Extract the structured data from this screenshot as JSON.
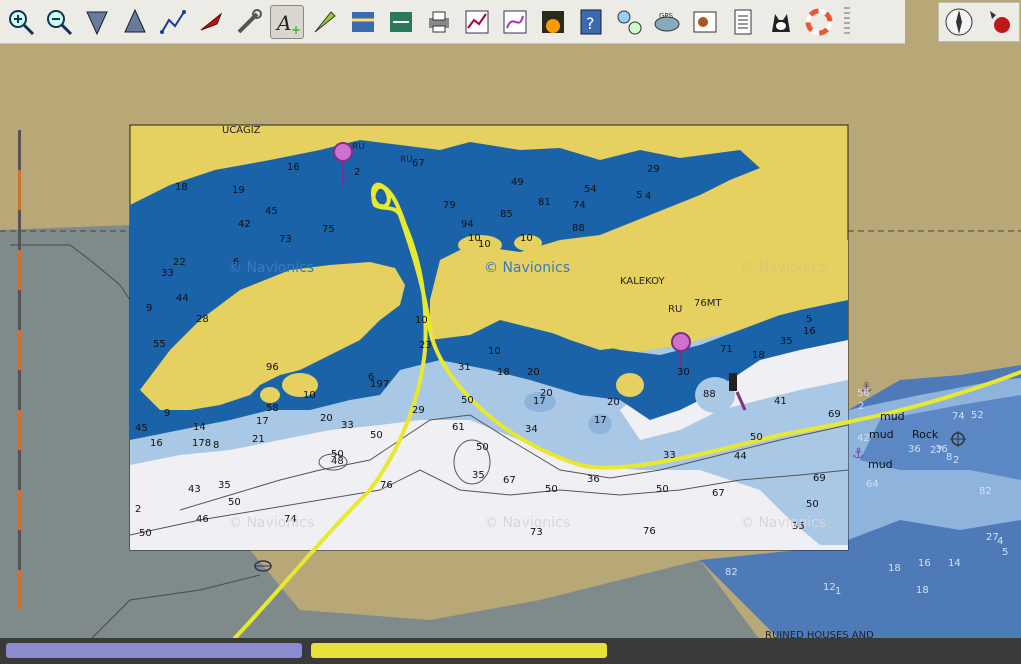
{
  "toolbar": {
    "tools": [
      {
        "name": "zoom-in-icon"
      },
      {
        "name": "zoom-out-icon"
      },
      {
        "name": "north-up-icon"
      },
      {
        "name": "course-up-icon"
      },
      {
        "name": "route-icon"
      },
      {
        "name": "boat-icon"
      },
      {
        "name": "tools-icon"
      },
      {
        "name": "text-annotation-icon"
      },
      {
        "name": "measure-icon"
      },
      {
        "name": "tide-icon"
      },
      {
        "name": "current-icon"
      },
      {
        "name": "print-icon"
      },
      {
        "name": "graph-icon"
      },
      {
        "name": "track-icon"
      },
      {
        "name": "sunset-icon"
      },
      {
        "name": "help-icon"
      },
      {
        "name": "settings-icon"
      },
      {
        "name": "gps-icon"
      },
      {
        "name": "weather-icon"
      },
      {
        "name": "document-icon"
      },
      {
        "name": "husky-icon"
      },
      {
        "name": "lifebuoy-icon"
      }
    ]
  },
  "map": {
    "place_labels": {
      "ucagiz": "UCAGIZ",
      "kalekoy": "KALEKOY",
      "ru1": "RU",
      "ru2": "RU",
      "ru3": "RU",
      "mt": "76MT",
      "mud1": "mud",
      "mud2": "mud",
      "mud3": "mud",
      "ruined": "RUINED HOUSES AND",
      "rock": "Rock"
    },
    "watermark": "© Navionics",
    "soundings_inner": [
      [
        "16",
        287,
        170
      ],
      [
        "19",
        232,
        193
      ],
      [
        "45",
        265,
        214
      ],
      [
        "42",
        238,
        227
      ],
      [
        "73",
        279,
        242
      ],
      [
        "75",
        322,
        232
      ],
      [
        "6",
        233,
        265
      ],
      [
        "22",
        173,
        265
      ],
      [
        "44",
        176,
        301
      ],
      [
        "33",
        161,
        276
      ],
      [
        "9",
        146,
        311
      ],
      [
        "55",
        153,
        347
      ],
      [
        "28",
        196,
        322
      ],
      [
        "18",
        175,
        190
      ],
      [
        "2",
        354,
        175
      ],
      [
        "67",
        412,
        166
      ],
      [
        "79",
        443,
        208
      ],
      [
        "94",
        461,
        227
      ],
      [
        "85",
        500,
        217
      ],
      [
        "81",
        538,
        205
      ],
      [
        "74",
        573,
        208
      ],
      [
        "54",
        584,
        192
      ],
      [
        "5",
        636,
        198
      ],
      [
        "4",
        645,
        199
      ],
      [
        "29",
        647,
        172
      ],
      [
        "49",
        511,
        185
      ],
      [
        "10",
        468,
        241
      ],
      [
        "10S",
        478,
        247
      ],
      [
        "10",
        520,
        241
      ],
      [
        "88",
        572,
        231
      ],
      [
        "10",
        415,
        323
      ],
      [
        "23",
        419,
        348
      ],
      [
        "10",
        488,
        354
      ],
      [
        "18",
        497,
        375
      ],
      [
        "20",
        527,
        375
      ],
      [
        "31",
        458,
        370
      ],
      [
        "50",
        461,
        403
      ],
      [
        "34",
        525,
        432
      ],
      [
        "61",
        452,
        430
      ],
      [
        "20",
        540,
        396
      ],
      [
        "17",
        533,
        404
      ],
      [
        "20",
        607,
        405
      ],
      [
        "17",
        594,
        423
      ],
      [
        "50",
        476,
        450
      ],
      [
        "35",
        472,
        478
      ],
      [
        "67",
        503,
        483
      ],
      [
        "50",
        545,
        492
      ],
      [
        "36",
        587,
        482
      ],
      [
        "33",
        663,
        458
      ],
      [
        "50",
        656,
        492
      ],
      [
        "44",
        734,
        459
      ],
      [
        "67",
        712,
        496
      ],
      [
        "50",
        750,
        440
      ],
      [
        "41",
        774,
        404
      ],
      [
        "69",
        828,
        417
      ],
      [
        "69",
        813,
        481
      ],
      [
        "50",
        806,
        507
      ],
      [
        "76",
        643,
        534
      ],
      [
        "73",
        530,
        535
      ],
      [
        "35",
        792,
        529
      ],
      [
        "16",
        803,
        334
      ],
      [
        "5",
        806,
        322
      ],
      [
        "35",
        780,
        344
      ],
      [
        "18",
        752,
        358
      ],
      [
        "71",
        720,
        352
      ],
      [
        "30",
        677,
        375
      ],
      [
        "88",
        703,
        397
      ],
      [
        "19",
        370,
        387
      ],
      [
        "7",
        383,
        387
      ],
      [
        "6",
        368,
        380
      ],
      [
        "20",
        320,
        421
      ],
      [
        "33",
        341,
        428
      ],
      [
        "50",
        370,
        438
      ],
      [
        "29",
        412,
        413
      ],
      [
        "10",
        303,
        398
      ],
      [
        "58",
        266,
        411
      ],
      [
        "17",
        256,
        424
      ],
      [
        "21",
        252,
        442
      ],
      [
        "8",
        213,
        448
      ],
      [
        "178",
        192,
        446
      ],
      [
        "14",
        193,
        430
      ],
      [
        "16",
        150,
        446
      ],
      [
        "45",
        135,
        431
      ],
      [
        "96",
        266,
        370
      ],
      [
        "9",
        164,
        416
      ],
      [
        "50",
        331,
        457
      ],
      [
        "48",
        331,
        464
      ],
      [
        "43",
        188,
        492
      ],
      [
        "35",
        218,
        488
      ],
      [
        "50",
        228,
        505
      ],
      [
        "46",
        196,
        522
      ],
      [
        "74",
        284,
        522
      ],
      [
        "76",
        380,
        488
      ],
      [
        "2",
        135,
        512
      ],
      [
        "50",
        139,
        536
      ]
    ],
    "soundings_outer": [
      [
        "82",
        725,
        575
      ],
      [
        "12",
        823,
        590
      ],
      [
        "1",
        835,
        594
      ],
      [
        "18",
        888,
        571
      ],
      [
        "18",
        916,
        593
      ],
      [
        "16",
        918,
        566
      ],
      [
        "14",
        948,
        566
      ],
      [
        "64",
        866,
        487
      ],
      [
        "74",
        952,
        419
      ],
      [
        "36",
        908,
        452
      ],
      [
        "36",
        935,
        452
      ],
      [
        "8",
        946,
        460
      ],
      [
        "52",
        971,
        418
      ],
      [
        "82",
        979,
        494
      ],
      [
        "27",
        986,
        540
      ],
      [
        "4",
        997,
        544
      ],
      [
        "5",
        1002,
        555
      ],
      [
        "2",
        858,
        409
      ],
      [
        "56",
        857,
        396
      ],
      [
        "42",
        857,
        441
      ],
      [
        "27",
        930,
        453
      ],
      [
        "2",
        953,
        463
      ]
    ]
  },
  "compass": {
    "name": "compass-icon"
  },
  "status": {
    "left_bar": "",
    "right_bar": ""
  }
}
